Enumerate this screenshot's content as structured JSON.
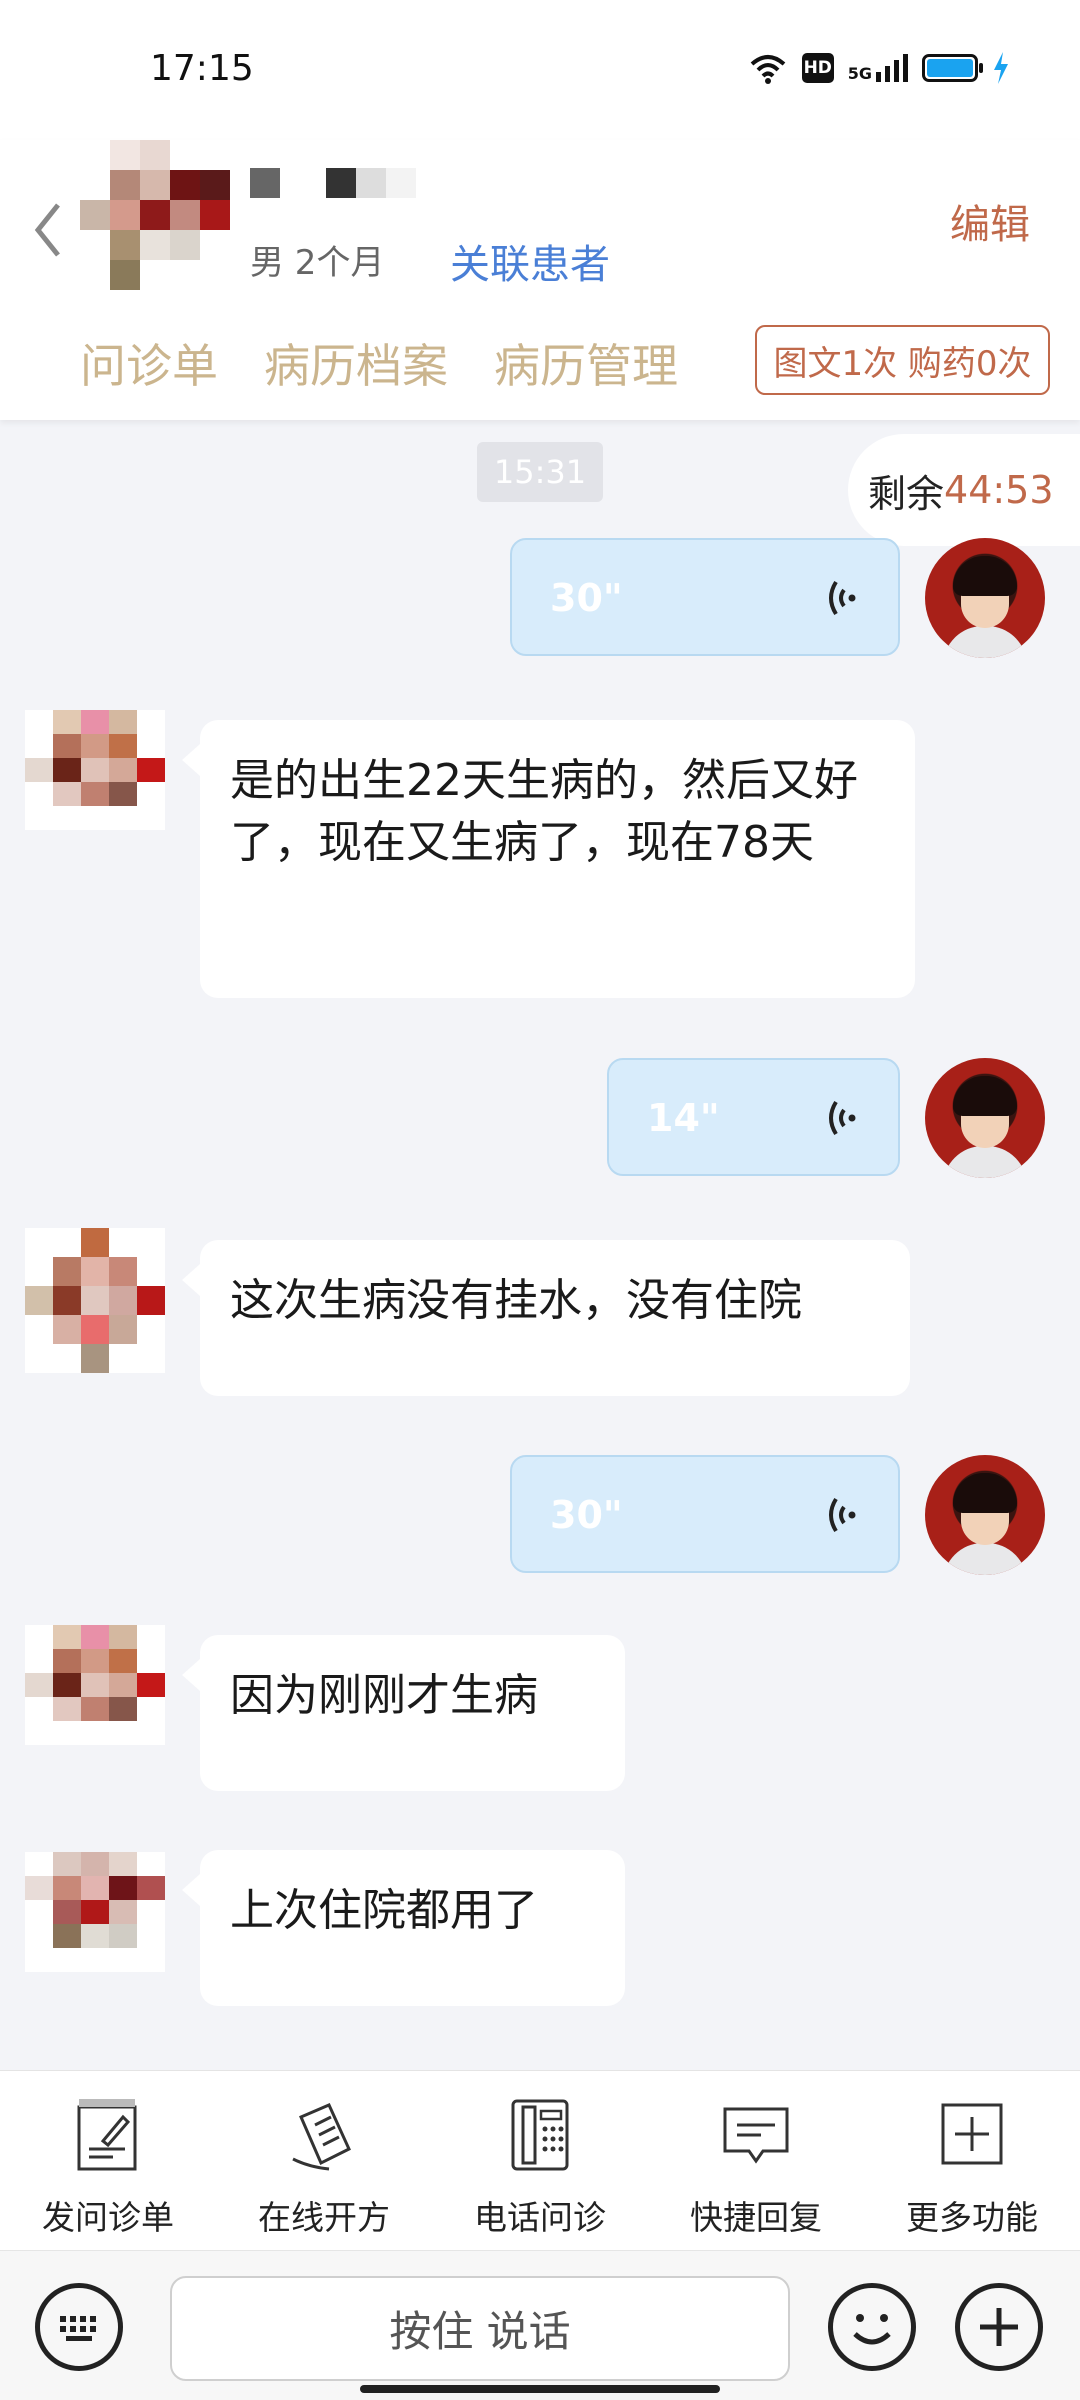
{
  "status_bar": {
    "time": "17:15",
    "hd_label": "HD",
    "network_label": "5G"
  },
  "header": {
    "patient_meta": "男 2个月",
    "link_patient_label": "关联患者",
    "edit_label": "编辑",
    "tabs": [
      "问诊单",
      "病历档案",
      "病历管理"
    ],
    "service_badge": "图文1次 购药0次"
  },
  "chat": {
    "time_chip": "15:31",
    "remaining_label": "剩余",
    "remaining_time": "44:53",
    "messages": [
      {
        "from": "doctor",
        "type": "voice",
        "duration": "30\""
      },
      {
        "from": "patient",
        "type": "text",
        "text": "是的出生22天生病的，然后又好了，现在又生病了，现在78天"
      },
      {
        "from": "doctor",
        "type": "voice",
        "duration": "14\""
      },
      {
        "from": "patient",
        "type": "text",
        "text": "这次生病没有挂水，没有住院"
      },
      {
        "from": "doctor",
        "type": "voice",
        "duration": "30\""
      },
      {
        "from": "patient",
        "type": "text",
        "text": "因为刚刚才生病"
      },
      {
        "from": "patient",
        "type": "text",
        "text": "上次住院都用了"
      }
    ]
  },
  "toolbar": {
    "items": [
      {
        "label": "发问诊单",
        "icon": "form-icon"
      },
      {
        "label": "在线开方",
        "icon": "prescription-icon"
      },
      {
        "label": "电话问诊",
        "icon": "phone-icon"
      },
      {
        "label": "快捷回复",
        "icon": "quick-reply-icon"
      },
      {
        "label": "更多功能",
        "icon": "more-icon"
      }
    ]
  },
  "input_bar": {
    "hold_to_talk": "按住 说话"
  },
  "colors": {
    "accent": "#c0694a",
    "tab_text": "#cbb58e",
    "link": "#4a7fd6",
    "voice_bubble": "#d8ecfb",
    "background": "#f3f4f8"
  }
}
